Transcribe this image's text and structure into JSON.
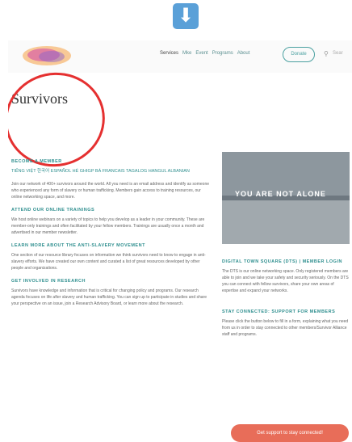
{
  "nav": {
    "items": [
      "Services",
      "Mke",
      "Event",
      "Programs",
      "About"
    ],
    "donate_label": "Donate",
    "search_text": "Sear"
  },
  "page": {
    "title": "Survivors",
    "become_member": "BECOME A MEMBER",
    "languages": "TIẾNG VIỆT  한국어  ESPAÑOL  HÉ GHIGP  BÁ  FRANCAIS  TAGALOG  HANGUL  ALBANIAN",
    "intro": "Join our network of 400+ survivors around the world. All you need is an email address and identify as someone who experienced any form of slavery or human trafficking. Members gain access to training resources, our online networking space, and more.",
    "sections": [
      {
        "heading": "ATTEND OUR ONLINE TRAININGS",
        "body": "We host online webinars on a variety of topics to help you develop as a leader in your community. These are member-only trainings and often facilitated by your fellow members. Trainings are usually once a month and advertised in our member newsletter."
      },
      {
        "heading": "LEARN MORE ABOUT THE ANTI-SLAVERY MOVEMENT",
        "body": "One section of our resource library focuses on information we think survivors need to know to engage in anti-slavery efforts. We have created our own content and curated a list of great resources developed by other people and organizations."
      },
      {
        "heading": "GET INVOLVED IN RESEARCH",
        "body": "Survivors have knowledge and information that is critical for changing policy and programs. Our research agenda focuses on life after slavery and human trafficking. You can sign up to participate in studies and share your perspective on an issue, join a Research Advisory Board, or learn more about the research."
      }
    ]
  },
  "sidebar": {
    "photo_caption": "YOU ARE NOT ALONE",
    "sections": [
      {
        "heading": "DIGITAL TOWN SQUARE (DTS) | MEMBER LOGIN",
        "body": "The DTS is our online networking space. Only registered members are able to join and we take your safety and security seriously. On the DTS you can connect with fellow survivors, share your own areas of expertise and expand your networks."
      },
      {
        "heading": "STAY CONNECTED: SUPPORT FOR MEMBERS",
        "body": "Please click the button below to fill in a form, explaining what you need from us in order to stay connected to other members/Survivor Alliance staff and programs."
      }
    ],
    "cta_label": "Get support to stay connected!"
  },
  "colors": {
    "accent": "#2f8f8f",
    "cta": "#e86d59",
    "annotation": "#e53030"
  }
}
